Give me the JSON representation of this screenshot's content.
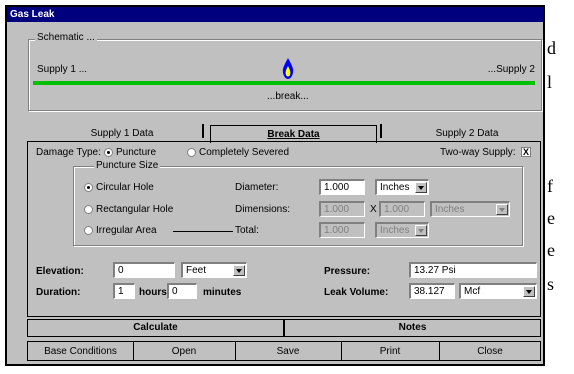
{
  "window": {
    "title": "Gas Leak"
  },
  "background_text": [
    "d",
    "l",
    "f",
    "e",
    "e",
    "s"
  ],
  "schematic": {
    "label": "Schematic ...",
    "supply1": "Supply 1 ...",
    "supply2": "...Supply 2",
    "break_label": "...break..."
  },
  "tabs": [
    {
      "label": "Supply 1 Data",
      "active": false
    },
    {
      "label": "Break Data",
      "active": true
    },
    {
      "label": "Supply 2 Data",
      "active": false
    }
  ],
  "damage_type": {
    "label": "Damage Type:",
    "options": [
      {
        "label": "Puncture",
        "selected": true
      },
      {
        "label": "Completely Severed",
        "selected": false
      }
    ]
  },
  "two_way_supply": {
    "label": "Two-way Supply:",
    "checked": true,
    "mark": "X"
  },
  "puncture_size": {
    "label": "Puncture Size",
    "circular": {
      "label": "Circular Hole",
      "selected": true,
      "field_label": "Diameter:",
      "value": "1.000",
      "unit": "Inches"
    },
    "rectangular": {
      "label": "Rectangular Hole",
      "selected": false,
      "field_label": "Dimensions:",
      "value1": "1.000",
      "separator": "X",
      "value2": "1.000",
      "unit": "Inches"
    },
    "irregular": {
      "label": "Irregular Area",
      "selected": false,
      "field_label": "Total:",
      "value": "1.000",
      "unit": "Inches"
    }
  },
  "elevation": {
    "label": "Elevation:",
    "value": "0",
    "unit": "Feet"
  },
  "duration": {
    "label": "Duration:",
    "hours_value": "1",
    "hours_label": "hours",
    "minutes_value": "0",
    "minutes_label": "minutes"
  },
  "pressure": {
    "label": "Pressure:",
    "value": "13.27 Psi"
  },
  "leak_volume": {
    "label": "Leak Volume:",
    "value": "38.127",
    "unit": "Mcf"
  },
  "actions": {
    "calculate": "Calculate",
    "notes": "Notes"
  },
  "bottom_buttons": [
    "Base Conditions",
    "Open",
    "Save",
    "Print",
    "Close"
  ],
  "colors": {
    "title_bar": "#00007f",
    "pipe": "#00c000",
    "flame_outer": "#0000ff",
    "flame_inner": "#ffff00",
    "face": "#c0c0c0"
  }
}
